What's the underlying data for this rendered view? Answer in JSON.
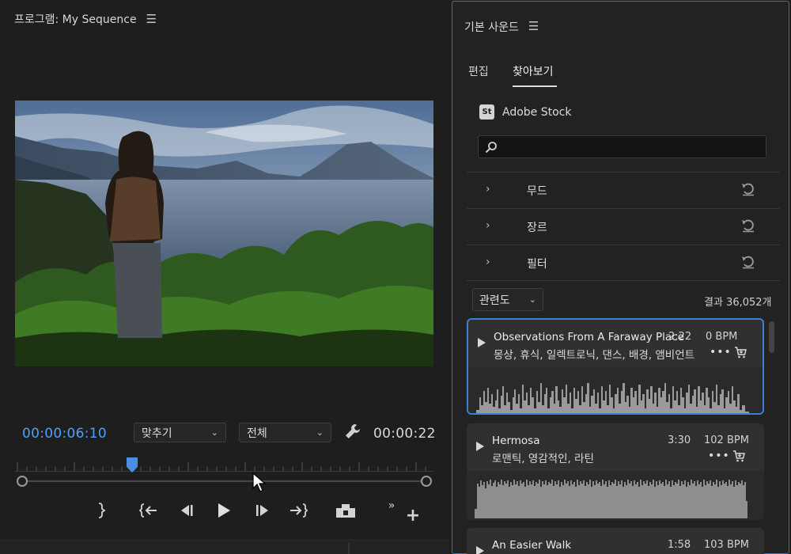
{
  "program": {
    "title": "프로그램: My Sequence",
    "timecode_current": "00:00:06:10",
    "timecode_duration": "00:00:22",
    "fit_dropdown": "맞추기",
    "quality_dropdown": "전체"
  },
  "sound_panel": {
    "title": "기본 사운드",
    "tabs": [
      {
        "label": "편집",
        "active": false
      },
      {
        "label": "찾아보기",
        "active": true
      }
    ],
    "stock": {
      "badge": "St",
      "label": "Adobe Stock"
    },
    "search": {
      "value": "",
      "placeholder": ""
    },
    "filters": [
      {
        "label": "무드"
      },
      {
        "label": "장르"
      },
      {
        "label": "필터"
      }
    ],
    "sort": {
      "selected": "관련도"
    },
    "result_count": "결과 36,052개",
    "tracks": [
      {
        "title": "Observations From A Faraway Place",
        "duration": "2:22",
        "bpm": "0 BPM",
        "tags": "몽상, 휴식, 일렉트로닉, 댄스, 배경, 앰비언트",
        "selected": true
      },
      {
        "title": "Hermosa",
        "duration": "3:30",
        "bpm": "102 BPM",
        "tags": "로맨틱, 영감적인, 라틴",
        "selected": false
      },
      {
        "title": "An Easier Walk",
        "duration": "1:58",
        "bpm": "103 BPM",
        "tags": "",
        "selected": false
      }
    ]
  },
  "colors": {
    "accent": "#4ea0ff",
    "selection_border": "#3c7fd6",
    "panel_background": "#222222"
  }
}
